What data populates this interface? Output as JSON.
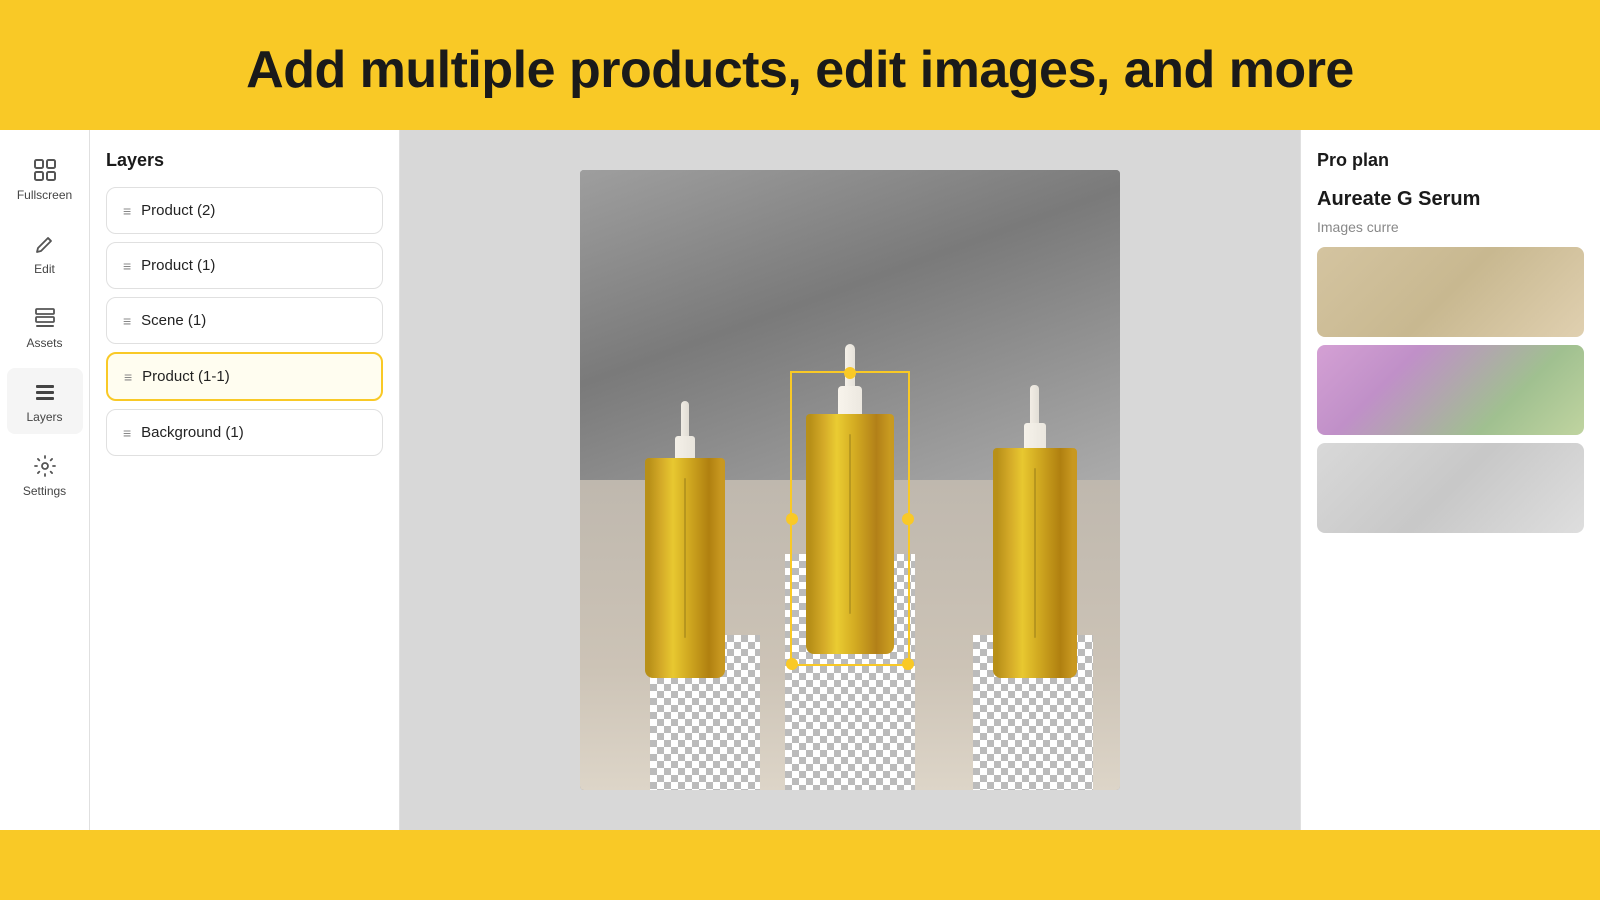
{
  "hero": {
    "title": "Add multiple products, edit images, and more"
  },
  "sidebar": {
    "items": [
      {
        "id": "fullscreen",
        "label": "Fullscreen",
        "icon": "fullscreen-icon"
      },
      {
        "id": "edit",
        "label": "Edit",
        "icon": "edit-icon"
      },
      {
        "id": "assets",
        "label": "Assets",
        "icon": "assets-icon"
      },
      {
        "id": "layers",
        "label": "Layers",
        "icon": "layers-icon",
        "active": true
      },
      {
        "id": "settings",
        "label": "Settings",
        "icon": "settings-icon"
      }
    ]
  },
  "layers_panel": {
    "title": "Layers",
    "items": [
      {
        "id": "product-2",
        "label": "Product (2)",
        "active": false
      },
      {
        "id": "product-1",
        "label": "Product (1)",
        "active": false
      },
      {
        "id": "scene-1",
        "label": "Scene (1)",
        "active": false
      },
      {
        "id": "product-1-1",
        "label": "Product (1-1)",
        "active": true
      },
      {
        "id": "background-1",
        "label": "Background (1)",
        "active": false
      }
    ]
  },
  "right_panel": {
    "pro_plan_label": "Pro plan",
    "product_name": "Aureate G Serum",
    "images_label": "Images curre"
  },
  "colors": {
    "accent": "#F9C926",
    "active_border": "#F9C926",
    "active_bg": "#fffdf0"
  }
}
